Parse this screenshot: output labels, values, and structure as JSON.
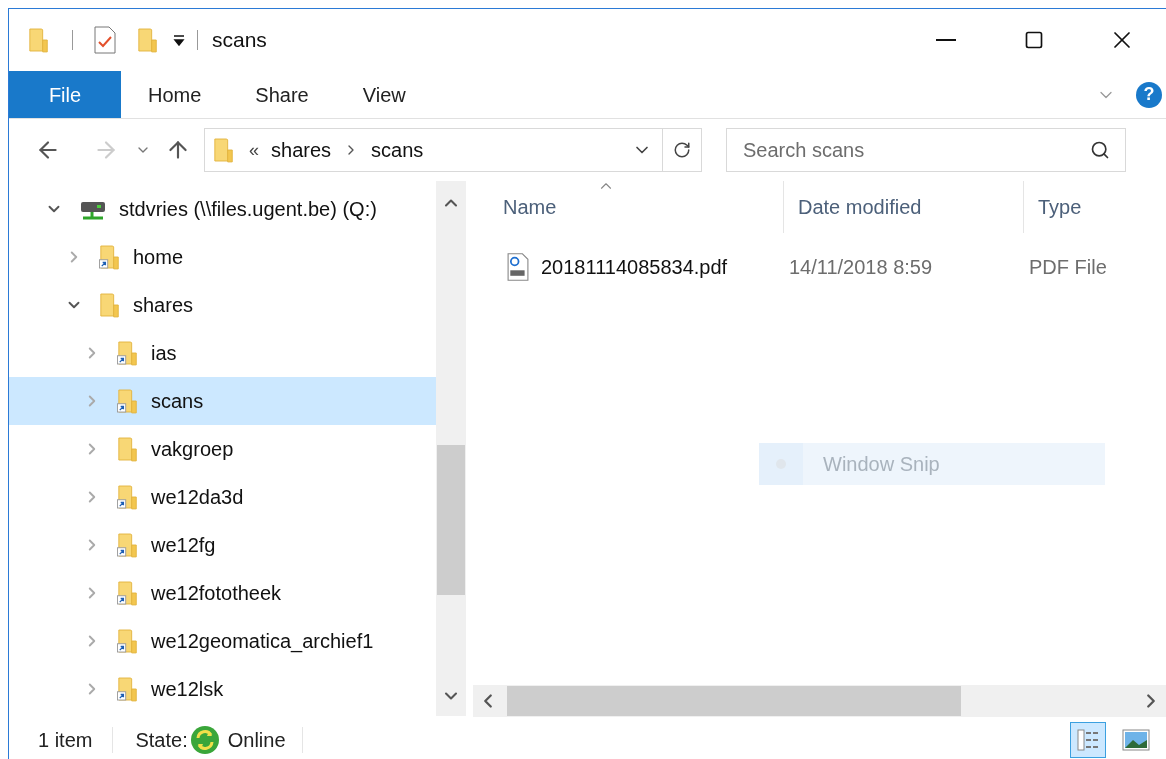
{
  "window": {
    "title": "scans"
  },
  "ribbon": {
    "tabs": [
      {
        "label": "File",
        "selected": true
      },
      {
        "label": "Home",
        "selected": false
      },
      {
        "label": "Share",
        "selected": false
      },
      {
        "label": "View",
        "selected": false
      }
    ],
    "help": "?"
  },
  "address_bar": {
    "overflow": "«",
    "crumbs": [
      "shares",
      "scans"
    ]
  },
  "search": {
    "placeholder": "Search scans"
  },
  "nav_tree": [
    {
      "label": "stdvries (\\\\files.ugent.be) (Q:)",
      "kind": "drive",
      "expanded": true,
      "selected": false,
      "children": [
        {
          "label": "home",
          "kind": "shortcut",
          "expanded": false,
          "selected": false
        },
        {
          "label": "shares",
          "kind": "folder",
          "expanded": true,
          "selected": false,
          "children": [
            {
              "label": "ias",
              "kind": "shortcut",
              "expanded": false,
              "selected": false
            },
            {
              "label": "scans",
              "kind": "shortcut",
              "expanded": false,
              "selected": true
            },
            {
              "label": "vakgroep",
              "kind": "folder",
              "expanded": false,
              "selected": false
            },
            {
              "label": "we12da3d",
              "kind": "shortcut",
              "expanded": false,
              "selected": false
            },
            {
              "label": "we12fg",
              "kind": "shortcut",
              "expanded": false,
              "selected": false
            },
            {
              "label": "we12fototheek",
              "kind": "shortcut",
              "expanded": false,
              "selected": false
            },
            {
              "label": "we12geomatica_archief1",
              "kind": "shortcut",
              "expanded": false,
              "selected": false
            },
            {
              "label": "we12lsk",
              "kind": "shortcut",
              "expanded": false,
              "selected": false
            }
          ]
        }
      ]
    }
  ],
  "columns": [
    {
      "label": "Name",
      "sorted": true
    },
    {
      "label": "Date modified",
      "sorted": false
    },
    {
      "label": "Type",
      "sorted": false
    }
  ],
  "files": [
    {
      "name": "20181114085834.pdf",
      "date": "14/11/2018 8:59",
      "type": "PDF File"
    }
  ],
  "tooltip": {
    "label": "Window Snip"
  },
  "status_bar": {
    "count": "1 item",
    "state_label": "State:",
    "state": "Online"
  },
  "views": [
    {
      "kind": "details",
      "selected": true
    },
    {
      "kind": "large_icons",
      "selected": false
    }
  ]
}
